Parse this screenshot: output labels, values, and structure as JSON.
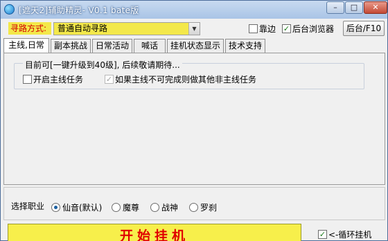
{
  "window": {
    "title": "[遮天2]辅助精灵- V0.1 bate版",
    "min_label": "–",
    "max_label": "□",
    "close_label": "✕"
  },
  "toolbar": {
    "mode_label": "寻路方式:",
    "mode_value": "普通自动寻路",
    "edge_label": "靠边",
    "edge_checked": false,
    "bg_browser_label": "后台浏览器",
    "bg_browser_checked": true,
    "background_button": "后台/F10"
  },
  "tabs": [
    {
      "label": "主线,日常",
      "active": true
    },
    {
      "label": "副本挑战",
      "active": false
    },
    {
      "label": "日常活动",
      "active": false
    },
    {
      "label": "喊话",
      "active": false
    },
    {
      "label": "挂机状态显示",
      "active": false
    },
    {
      "label": "技术支持",
      "active": false
    }
  ],
  "mainline": {
    "group_title": "目前可[一键升级到40级], 后续敬请期待...",
    "enable_label": "开启主线任务",
    "enable_checked": false,
    "fallback_label": "如果主线不可完成则做其他非主线任务",
    "fallback_checked": true
  },
  "career": {
    "label": "选择职业",
    "options": [
      {
        "label": "仙音(默认)",
        "selected": true
      },
      {
        "label": "魔尊",
        "selected": false
      },
      {
        "label": "战神",
        "selected": false
      },
      {
        "label": "罗刹",
        "selected": false
      }
    ]
  },
  "start_button": "开始挂机",
  "loop_label": "<-循环挂机",
  "loop_checked": true
}
